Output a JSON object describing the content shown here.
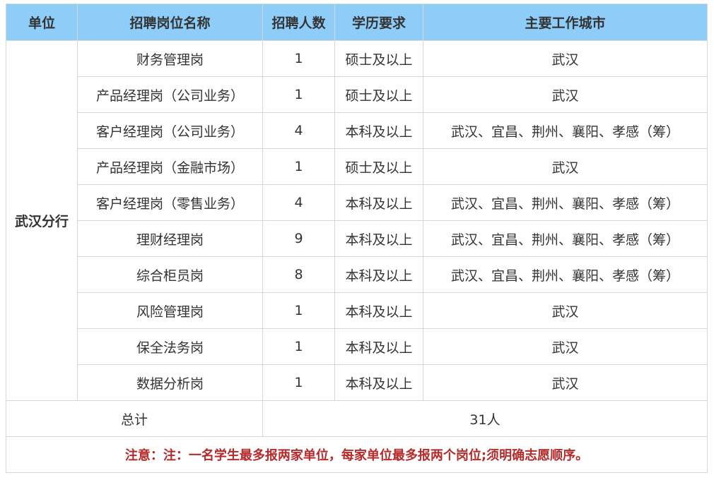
{
  "headers": [
    "单位",
    "招聘岗位名称",
    "招聘人数",
    "学历要求",
    "主要工作城市"
  ],
  "unit": "武汉分行",
  "rows": [
    {
      "position": "财务管理岗",
      "count": "1",
      "education": "硕士及以上",
      "city": "武汉"
    },
    {
      "position": "产品经理岗（公司业务）",
      "count": "1",
      "education": "硕士及以上",
      "city": "武汉"
    },
    {
      "position": "客户经理岗（公司业务）",
      "count": "4",
      "education": "本科及以上",
      "city": "武汉、宜昌、荆州、襄阳、孝感（筹）"
    },
    {
      "position": "产品经理岗（金融市场）",
      "count": "1",
      "education": "硕士及以上",
      "city": "武汉"
    },
    {
      "position": "客户经理岗（零售业务）",
      "count": "4",
      "education": "本科及以上",
      "city": "武汉、宜昌、荆州、襄阳、孝感（筹）"
    },
    {
      "position": "理财经理岗",
      "count": "9",
      "education": "本科及以上",
      "city": "武汉、宜昌、荆州、襄阳、孝感（筹）"
    },
    {
      "position": "综合柜员岗",
      "count": "8",
      "education": "本科及以上",
      "city": "武汉、宜昌、荆州、襄阳、孝感（筹）"
    },
    {
      "position": "风险管理岗",
      "count": "1",
      "education": "本科及以上",
      "city": "武汉"
    },
    {
      "position": "保全法务岗",
      "count": "1",
      "education": "本科及以上",
      "city": "武汉"
    },
    {
      "position": "数据分析岗",
      "count": "1",
      "education": "本科及以上",
      "city": "武汉"
    }
  ],
  "total_label": "总计",
  "total_value": "31人",
  "note": "注意：注：一名学生最多报两家单位，每家单位最多报两个岗位;须明确志愿顺序。",
  "colors": {
    "header_bg": "#8ecdf8",
    "note": "#b52a2a",
    "border": "#d7d7d7"
  }
}
